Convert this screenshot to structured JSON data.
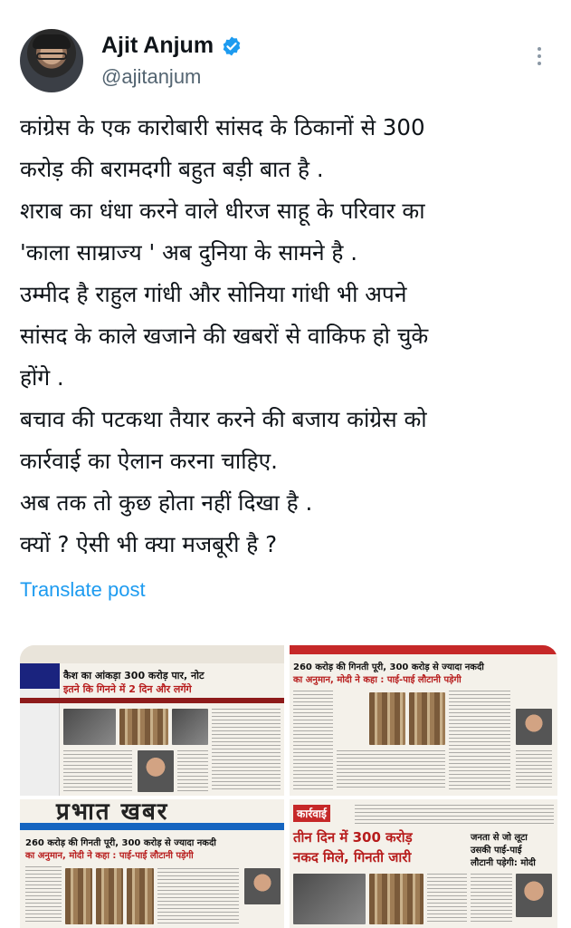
{
  "author": {
    "display_name": "Ajit Anjum",
    "handle": "@ajitanjum"
  },
  "icons": {
    "verified": "verified-badge-icon",
    "more": "more-options-icon"
  },
  "colors": {
    "accent": "#1d9bf0",
    "text": "#0f1419",
    "muted": "#536471"
  },
  "tweet": {
    "lines": [
      "कांग्रेस के एक कारोबारी सांसद के ठिकानों से 300",
      "करोड़ की बरामदगी बहुत बड़ी बात है .",
      "शराब का धंधा करने वाले धीरज साहू के परिवार का",
      "'काला साम्राज्य ' अब दुनिया के सामने है .",
      "उम्मीद है राहुल गांधी और सोनिया गांधी भी अपने",
      "सांसद के काले खजाने की खबरों से वाकिफ हो चुके",
      "होंगे .",
      "बचाव की पटकथा तैयार करने की बजाय कांग्रेस को",
      "कार्रवाई का ऐलान करना चाहिए.",
      "अब तक तो कुछ होता नहीं दिखा है .",
      "क्यों ? ऐसी भी क्या मजबूरी है ?"
    ],
    "translate_label": "Translate post"
  },
  "media": {
    "paper1": {
      "headline_1": "कैश का आंकड़ा 300 करोड़ पार, नोट",
      "headline_2": "इतने कि गिनने में 2 दिन और लगेंगे"
    },
    "paper2": {
      "headline_1": "260 करोड़ की गिनती पूरी, 300 करोड़ से ज्यादा नकदी",
      "headline_2": "का अनुमान, मोदी ने कहा : पाई-पाई लौटानी पड़ेगी"
    },
    "paper3": {
      "masthead": "प्रभात खबर",
      "headline_1": "260 करोड़ की गिनती पूरी, 300 करोड़ से ज्यादा नकदी",
      "headline_2": "का अनुमान, मोदी ने कहा : पाई-पाई लौटानी पड़ेगी"
    },
    "paper4": {
      "label": "कार्रवाई",
      "headline_1": "तीन दिन में 300 करोड़",
      "headline_2": "नकद मिले, गिनती जारी",
      "side_1": "जनता से जो लूटा",
      "side_2": "उसकी पाई-पाई",
      "side_3": "लौटानी पड़ेगी: मोदी"
    }
  }
}
